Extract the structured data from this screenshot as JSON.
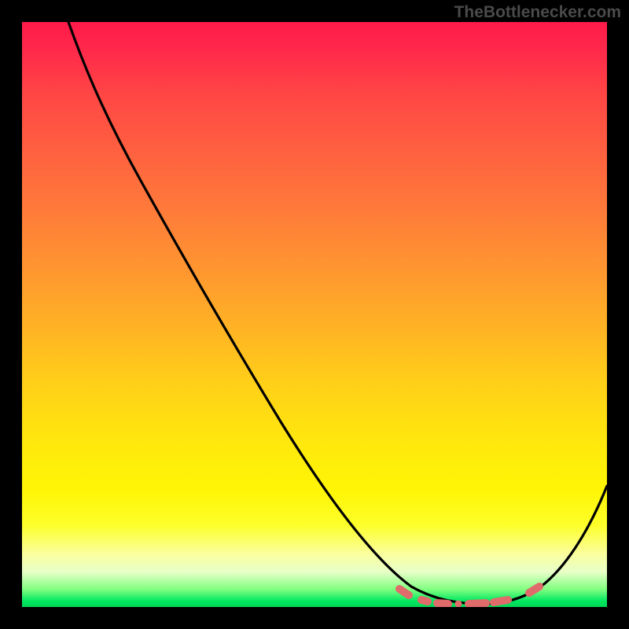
{
  "watermark": "TheBottlenecker.com",
  "chart_data": {
    "type": "line",
    "title": "",
    "xlabel": "",
    "ylabel": "",
    "xlim": [
      0,
      100
    ],
    "ylim": [
      0,
      100
    ],
    "grid": false,
    "legend": false,
    "background": "rainbow-gradient red-top green-bottom",
    "series": [
      {
        "name": "bottleneck-curve",
        "color": "#000000",
        "x": [
          8,
          12,
          18,
          25,
          33,
          41,
          49,
          56,
          62,
          66,
          70,
          74,
          77,
          80,
          83,
          86,
          89,
          92,
          95,
          98,
          100
        ],
        "values": [
          100,
          93,
          83,
          71,
          58,
          45,
          32,
          21,
          12,
          7,
          3.5,
          1.5,
          0.8,
          0.6,
          0.8,
          1.8,
          3.5,
          6.5,
          11,
          17,
          22
        ]
      }
    ],
    "markers": [
      {
        "name": "highlight-band-left",
        "x": 63,
        "y": 1.8
      },
      {
        "name": "highlight-band-mid",
        "x": 77,
        "y": 0.7
      },
      {
        "name": "highlight-band-right",
        "x": 88,
        "y": 2.2
      }
    ],
    "colors": {
      "gradient_top": "#ff1a4a",
      "gradient_mid": "#ffe80d",
      "gradient_bottom": "#00d858",
      "curve": "#000000",
      "marker": "#e06666"
    }
  }
}
